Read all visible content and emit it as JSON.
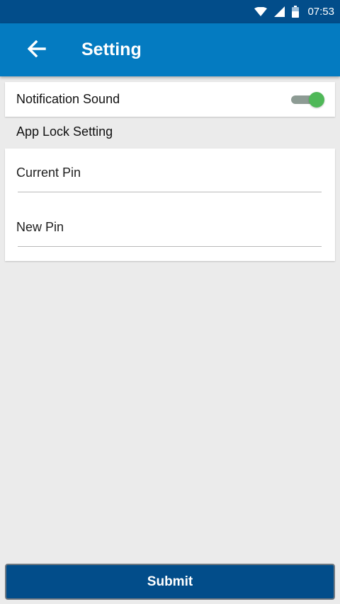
{
  "status_bar": {
    "time": "07:53",
    "icons": [
      "wifi-icon",
      "signal-icon",
      "battery-icon"
    ]
  },
  "app_bar": {
    "title": "Setting",
    "back_icon": "arrow-left-icon"
  },
  "notification": {
    "label": "Notification Sound",
    "toggle_on": true
  },
  "app_lock": {
    "heading": "App Lock Setting",
    "current_pin": {
      "placeholder": "Current Pin",
      "value": ""
    },
    "new_pin": {
      "placeholder": "New Pin",
      "value": ""
    }
  },
  "submit": {
    "label": "Submit"
  },
  "colors": {
    "status_bar": "#024d8a",
    "app_bar": "#047bc1",
    "background": "#ebebeb",
    "toggle_thumb": "#4fb858",
    "toggle_track": "#8d9b94",
    "submit_button": "#024d8a"
  }
}
